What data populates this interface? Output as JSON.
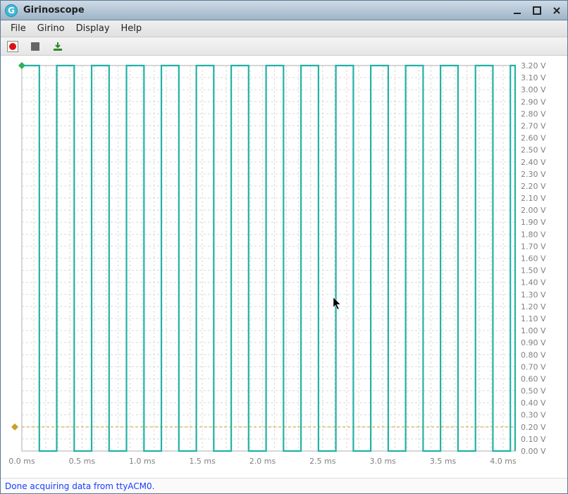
{
  "window": {
    "title": "Girinoscope",
    "app_icon_letter": "G"
  },
  "menu": {
    "file": "File",
    "girino": "Girino",
    "display": "Display",
    "help": "Help"
  },
  "toolbar": {
    "record_label": "Record",
    "stop_label": "Stop",
    "export_label": "Export"
  },
  "status": {
    "text": "Done acquiring data from ttyACM0."
  },
  "chart_data": {
    "type": "line",
    "title": "",
    "xlabel": "",
    "ylabel": "",
    "x_range_ms": [
      0.0,
      4.1
    ],
    "y_range_v": [
      0.0,
      3.2
    ],
    "x_major_ticks_ms": [
      0.0,
      0.5,
      1.0,
      1.5,
      2.0,
      2.5,
      3.0,
      3.5,
      4.0
    ],
    "x_minor_step_ms": 0.1,
    "y_ticks_v": [
      0.0,
      0.1,
      0.2,
      0.3,
      0.4,
      0.5,
      0.6,
      0.7,
      0.8,
      0.9,
      1.0,
      1.1,
      1.2,
      1.3,
      1.4,
      1.5,
      1.6,
      1.7,
      1.8,
      1.9,
      2.0,
      2.1,
      2.2,
      2.3,
      2.4,
      2.5,
      2.6,
      2.7,
      2.8,
      2.9,
      3.0,
      3.1,
      3.2
    ],
    "x_tick_labels": [
      "0.0 ms",
      "0.5 ms",
      "1.0 ms",
      "1.5 ms",
      "2.0 ms",
      "2.5 ms",
      "3.0 ms",
      "3.5 ms",
      "4.0 ms"
    ],
    "y_tick_labels": [
      "0.00 V",
      "0.10 V",
      "0.20 V",
      "0.30 V",
      "0.40 V",
      "0.50 V",
      "0.60 V",
      "0.70 V",
      "0.80 V",
      "0.90 V",
      "1.00 V",
      "1.10 V",
      "1.20 V",
      "1.30 V",
      "1.40 V",
      "1.50 V",
      "1.60 V",
      "1.70 V",
      "1.80 V",
      "1.90 V",
      "2.00 V",
      "2.10 V",
      "2.20 V",
      "2.30 V",
      "2.40 V",
      "2.50 V",
      "2.60 V",
      "2.70 V",
      "2.80 V",
      "2.90 V",
      "3.00 V",
      "3.10 V",
      "3.20 V"
    ],
    "trigger_level_v": 0.2,
    "trigger_marker_x_ms": 0.0,
    "trigger_marker_y_v": 3.2,
    "waveform": {
      "description": "square wave, low=0.00V high=3.20V, period≈0.29ms (~3.45kHz), duty≈50%, starts high at t=0",
      "low_v": 0.0,
      "high_v": 3.2,
      "period_ms": 0.29,
      "duty": 0.5,
      "edges_ms": [
        0.0,
        0.145,
        0.29,
        0.435,
        0.58,
        0.725,
        0.87,
        1.015,
        1.16,
        1.305,
        1.45,
        1.595,
        1.74,
        1.885,
        2.03,
        2.175,
        2.32,
        2.465,
        2.61,
        2.755,
        2.9,
        3.045,
        3.19,
        3.335,
        3.48,
        3.625,
        3.77,
        3.915,
        4.06,
        4.1
      ]
    },
    "colors": {
      "waveform": "#22b2a6",
      "grid_minor": "#d9d9d9",
      "grid_border": "#c9c9c9",
      "trigger_line": "#c9a02b",
      "trigger_marker": "#c9a02b",
      "start_marker": "#2bb24b",
      "axis_label": "#808080"
    }
  }
}
